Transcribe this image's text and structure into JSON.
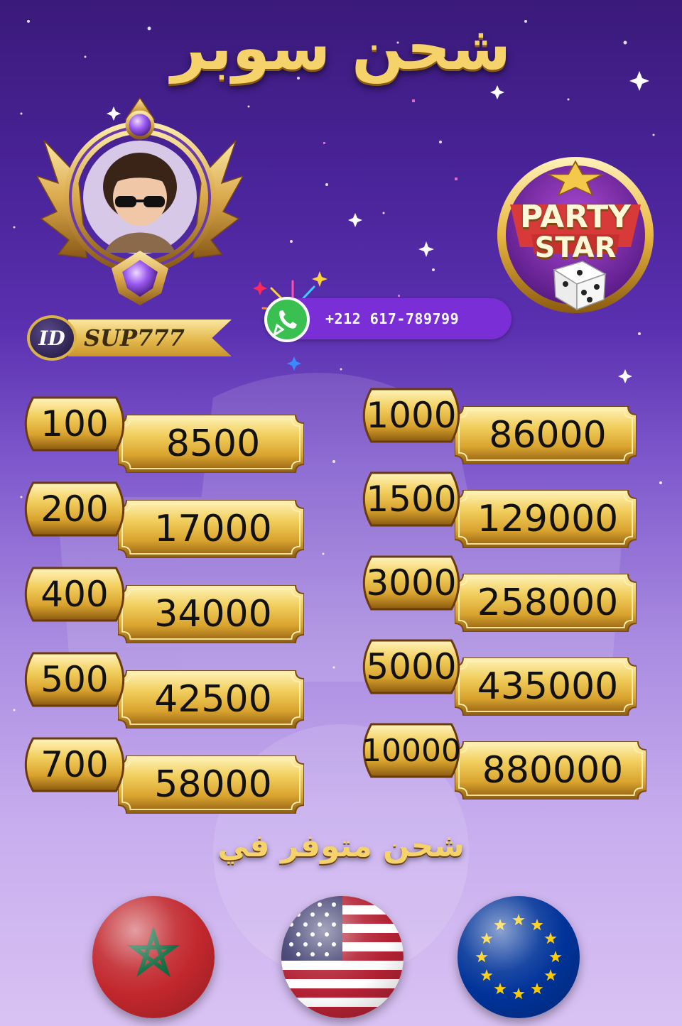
{
  "header": {
    "title": "شحن سوبر"
  },
  "profile": {
    "id_label": "ID",
    "id_value": "SUP777"
  },
  "contact": {
    "icon": "whatsapp-icon",
    "phone": "+212 617-789799"
  },
  "logo": {
    "line1": "PARTY",
    "line2": "STAR",
    "icon": "dice-icon"
  },
  "prices": {
    "left": [
      {
        "price": "100",
        "amount": "8500"
      },
      {
        "price": "200",
        "amount": "17000"
      },
      {
        "price": "400",
        "amount": "34000"
      },
      {
        "price": "500",
        "amount": "42500"
      },
      {
        "price": "700",
        "amount": "58000"
      }
    ],
    "right": [
      {
        "price": "1000",
        "amount": "86000"
      },
      {
        "price": "1500",
        "amount": "129000"
      },
      {
        "price": "3000",
        "amount": "258000"
      },
      {
        "price": "5000",
        "amount": "435000"
      },
      {
        "price": "10000",
        "amount": "880000"
      }
    ]
  },
  "footer": {
    "available_text": "شحن متوفر في",
    "flags": [
      "morocco-flag-icon",
      "usa-flag-icon",
      "eu-flag-icon"
    ]
  },
  "colors": {
    "gold": "#e9c04e",
    "purple_top": "#3a1a7a",
    "purple_bottom": "#d9c2f3",
    "pill": "#7a2fd6"
  }
}
